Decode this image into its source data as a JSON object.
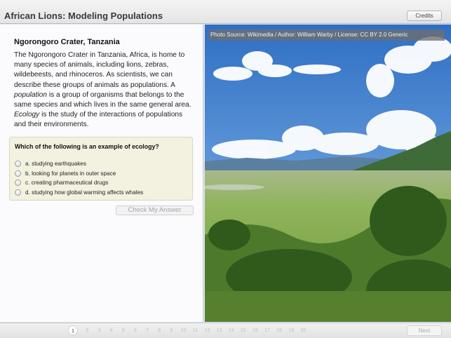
{
  "header": {
    "title": "African Lions: Modeling Populations",
    "credits_label": "Credits"
  },
  "lesson": {
    "heading": "Ngorongoro Crater, Tanzania",
    "paragraph": {
      "part1": "The Ngorongoro Crater in Tanzania, Africa, is home to many species of animals, including lions, zebras, wildebeests, and rhinoceros. As scientists, we can describe these groups of animals as populations. A ",
      "term1": "population",
      "part2": " is a group of organisms that belongs to the same species and which lives in the same general area. ",
      "term2": "Ecology",
      "part3": " is the study of the interactions of populations and their environments."
    }
  },
  "quiz": {
    "question": "Which of the following is an example of ecology?",
    "options": [
      "a. studying earthquakes",
      "b. looking for planets in outer space",
      "c. creating pharmaceutical drugs",
      "d. studying how global warming affects whales"
    ],
    "check_label": "Check My Answer"
  },
  "photo": {
    "caption": "Photo Source: Wikimedia / Author: William Warby / License: CC BY 2.0 Generic"
  },
  "pagination": {
    "current": "1",
    "pages": [
      "2",
      "3",
      "4",
      "5",
      "6",
      "7",
      "8",
      "9",
      "10",
      "11",
      "12",
      "13",
      "14",
      "15",
      "16",
      "17",
      "18",
      "19",
      "20"
    ],
    "next_label": "Next"
  },
  "colors": {
    "question_bg": "#f3f1e0",
    "panel_bg": "#fbfbfd",
    "sky": "#4d8ad0",
    "grass": "#7ea648"
  }
}
